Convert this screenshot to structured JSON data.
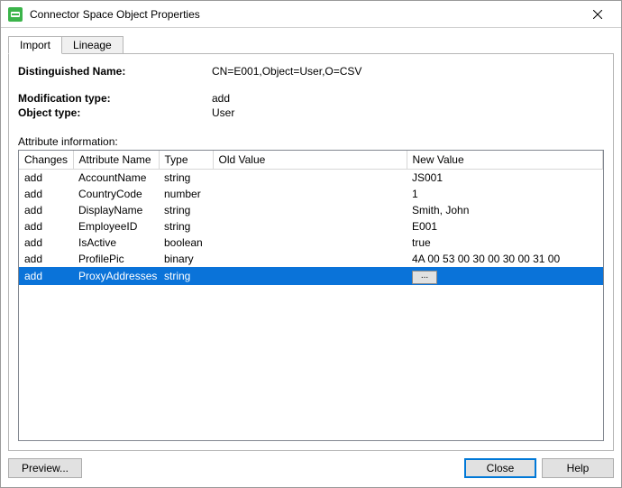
{
  "window": {
    "title": "Connector Space Object Properties"
  },
  "tabs": [
    {
      "label": "Import",
      "active": true
    },
    {
      "label": "Lineage",
      "active": false
    }
  ],
  "details": {
    "distinguished_name_label": "Distinguished Name:",
    "distinguished_name_value": "CN=E001,Object=User,O=CSV",
    "modification_type_label": "Modification type:",
    "modification_type_value": "add",
    "object_type_label": "Object type:",
    "object_type_value": "User"
  },
  "section_label": "Attribute information:",
  "columns": {
    "changes": "Changes",
    "attr_name": "Attribute Name",
    "type": "Type",
    "old_value": "Old Value",
    "new_value": "New Value"
  },
  "rows": [
    {
      "changes": "add",
      "name": "AccountName",
      "type": "string",
      "old": "",
      "new": "JS001",
      "selected": false,
      "ellipsis": false
    },
    {
      "changes": "add",
      "name": "CountryCode",
      "type": "number",
      "old": "",
      "new": "1",
      "selected": false,
      "ellipsis": false
    },
    {
      "changes": "add",
      "name": "DisplayName",
      "type": "string",
      "old": "",
      "new": "Smith, John",
      "selected": false,
      "ellipsis": false
    },
    {
      "changes": "add",
      "name": "EmployeeID",
      "type": "string",
      "old": "",
      "new": "E001",
      "selected": false,
      "ellipsis": false
    },
    {
      "changes": "add",
      "name": "IsActive",
      "type": "boolean",
      "old": "",
      "new": "true",
      "selected": false,
      "ellipsis": false
    },
    {
      "changes": "add",
      "name": "ProfilePic",
      "type": "binary",
      "old": "",
      "new": "4A 00 53 00 30 00 30 00 31 00",
      "selected": false,
      "ellipsis": false
    },
    {
      "changes": "add",
      "name": "ProxyAddresses",
      "type": "string",
      "old": "",
      "new": "",
      "selected": true,
      "ellipsis": true
    }
  ],
  "buttons": {
    "preview": "Preview...",
    "close": "Close",
    "help": "Help"
  },
  "ellipsis_label": "..."
}
